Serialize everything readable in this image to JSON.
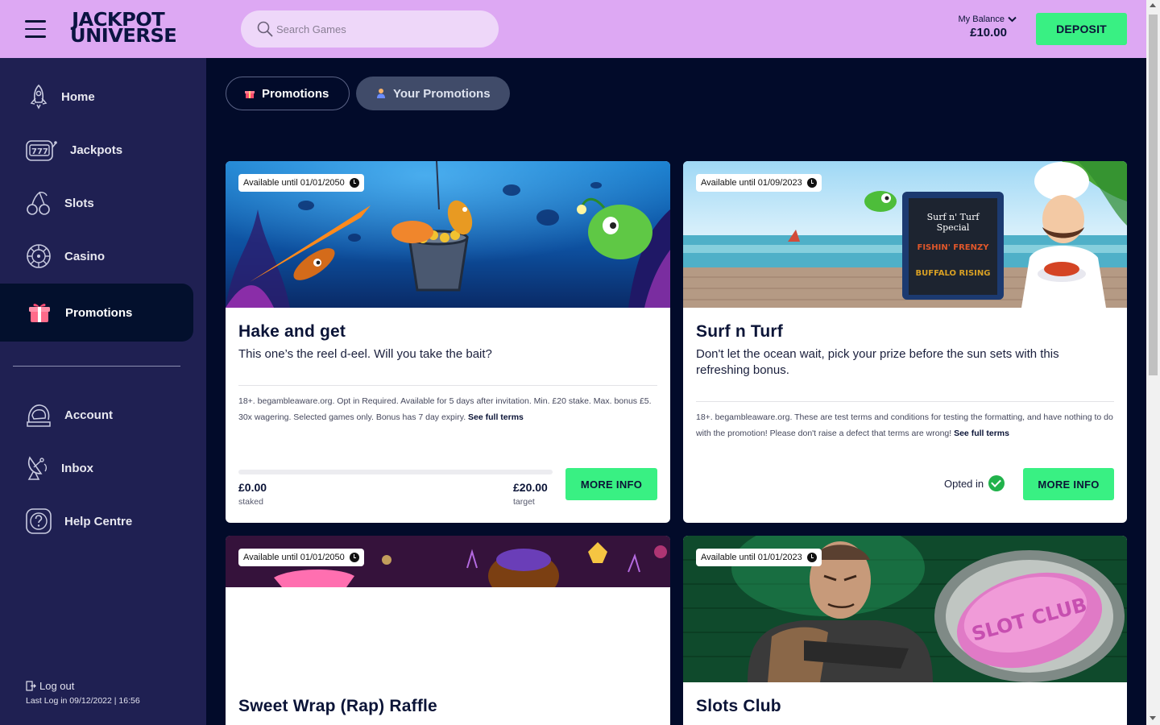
{
  "header": {
    "logo_line1": "JACKPOT",
    "logo_line2": "UNIVERSE",
    "search_placeholder": "Search Games",
    "balance_label": "My Balance",
    "balance_value": "£10.00",
    "deposit_label": "DEPOSIT"
  },
  "sidebar": {
    "items": [
      {
        "label": "Home",
        "icon": "rocket-icon"
      },
      {
        "label": "Jackpots",
        "icon": "slot-machine-icon"
      },
      {
        "label": "Slots",
        "icon": "cherries-icon"
      },
      {
        "label": "Casino",
        "icon": "roulette-icon"
      },
      {
        "label": "Promotions",
        "icon": "gift-icon"
      },
      {
        "label": "Account",
        "icon": "astronaut-helmet-icon"
      },
      {
        "label": "Inbox",
        "icon": "satellite-dish-icon"
      },
      {
        "label": "Help Centre",
        "icon": "question-icon"
      }
    ],
    "logout_label": "Log out",
    "last_login": "Last Log in 09/12/2022 | 16:56"
  },
  "tabs": {
    "promotions": "Promotions",
    "your_promotions": "Your Promotions"
  },
  "cards": [
    {
      "availability": "Available until 01/01/2050",
      "title": "Hake and get",
      "description": "This one’s the reel d-eel. Will you take the bait?",
      "terms": "18+. begambleaware.org. Opt in Required. Available for 5 days after invitation. Min. £20 stake. Max. bonus £5. 30x wagering. Selected games only. Bonus has 7 day expiry.",
      "terms_link": "See full terms",
      "staked_value": "£0.00",
      "staked_label": "staked",
      "target_value": "£20.00",
      "target_label": "target",
      "progress_fraction": 0,
      "button": "MORE INFO"
    },
    {
      "availability": "Available until 01/09/2023",
      "title": "Surf n Turf",
      "description": "Don't let the ocean wait,  pick your prize before the sun sets with this refreshing bonus.",
      "terms": "18+. begambleaware.org. These are test terms and conditions for testing the formatting, and have nothing to do with the promotion! Please don't raise a defect that terms are wrong!",
      "terms_link": "See full terms",
      "status": "Opted in",
      "button": "MORE INFO"
    },
    {
      "availability": "Available until 01/01/2050",
      "title": "Sweet Wrap (Rap) Raffle"
    },
    {
      "availability": "Available until 01/01/2023",
      "title": "Slots Club"
    }
  ],
  "image_texts": {
    "board_line1": "Surf n' Turf",
    "board_line2": "Special",
    "board_line3": "FISHIN' FRENZY",
    "board_line4": "BUFFALO RISING",
    "soap": "SLOT CLUB"
  }
}
